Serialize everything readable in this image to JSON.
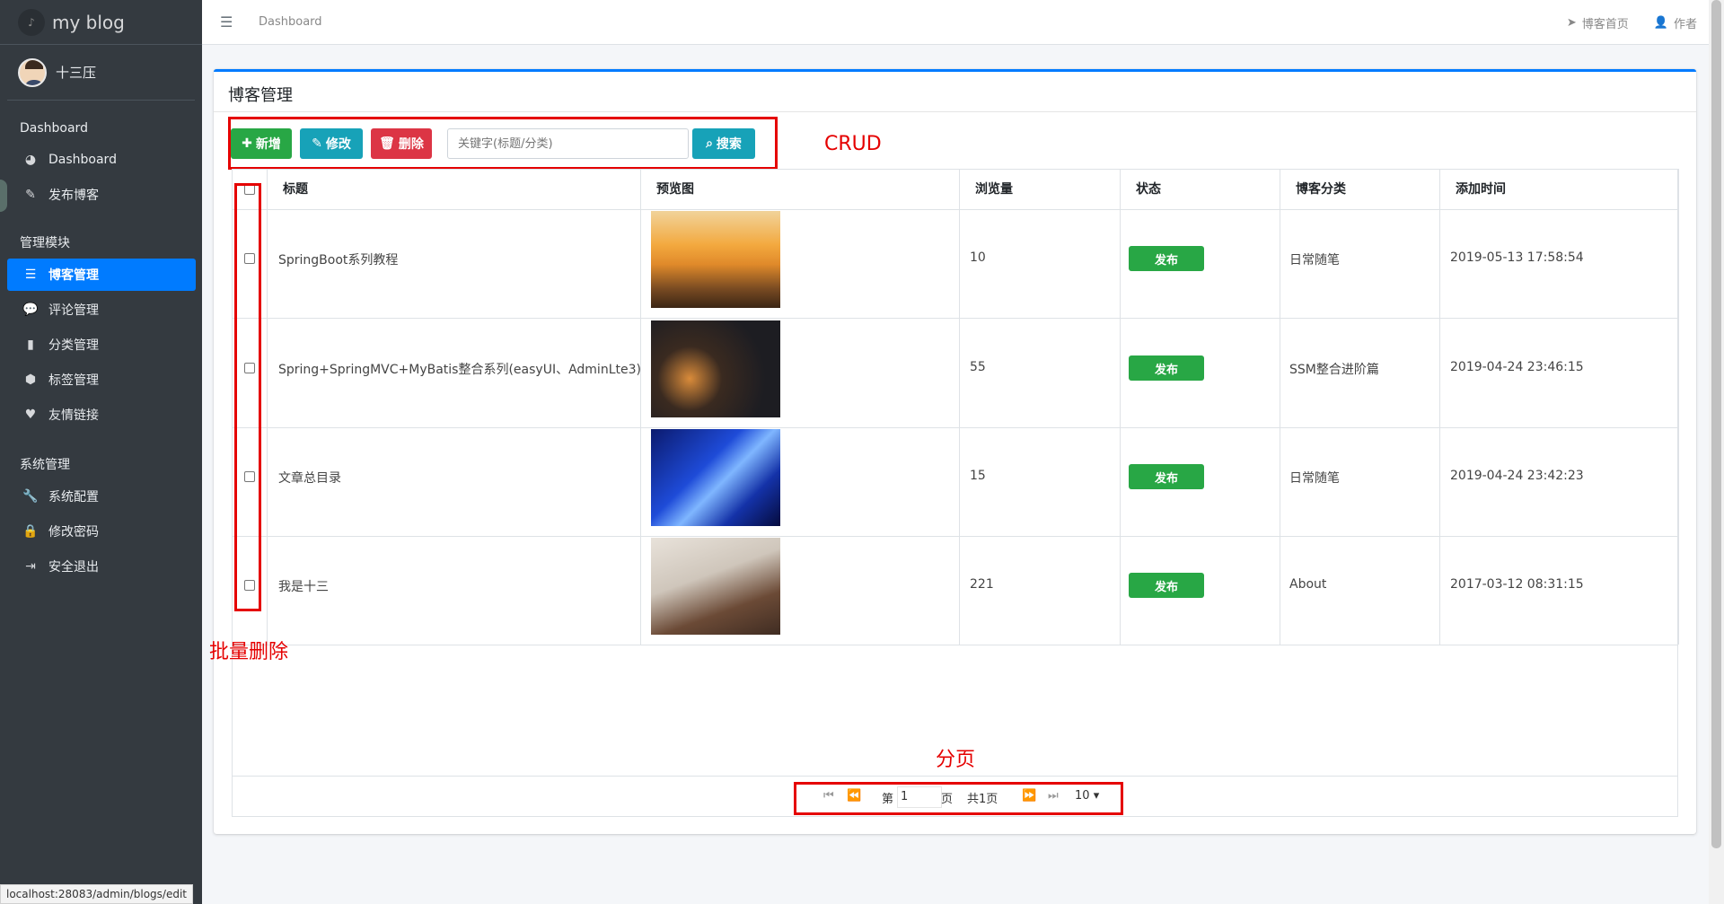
{
  "brand": {
    "title": "my blog"
  },
  "user": {
    "name": "十三压"
  },
  "nav": {
    "section_dashboard": "Dashboard",
    "dashboard": "Dashboard",
    "publish": "发布博客",
    "section_manage": "管理模块",
    "blog_manage": "博客管理",
    "comment_manage": "评论管理",
    "category_manage": "分类管理",
    "tag_manage": "标签管理",
    "friend_links": "友情链接",
    "section_system": "系统管理",
    "system_config": "系统配置",
    "change_password": "修改密码",
    "logout": "安全退出"
  },
  "topbar": {
    "breadcrumb": "Dashboard",
    "home": "博客首页",
    "author": "作者"
  },
  "card": {
    "title": "博客管理"
  },
  "toolbar": {
    "add": "新增",
    "edit": "修改",
    "delete": "删除",
    "search_placeholder": "关键字(标题/分类)",
    "search": "搜索"
  },
  "annotations": {
    "crud": "CRUD",
    "batch_delete": "批量删除",
    "paging": "分页"
  },
  "table": {
    "headers": [
      "标题",
      "预览图",
      "浏览量",
      "状态",
      "博客分类",
      "添加时间"
    ],
    "rows": [
      {
        "title": "SpringBoot系列教程",
        "views": "10",
        "status": "发布",
        "category": "日常随笔",
        "time": "2019-05-13 17:58:54"
      },
      {
        "title": "Spring+SpringMVC+MyBatis整合系列(easyUI、AdminLte3)",
        "views": "55",
        "status": "发布",
        "category": "SSM整合进阶篇",
        "time": "2019-04-24 23:46:15"
      },
      {
        "title": "文章总目录",
        "views": "15",
        "status": "发布",
        "category": "日常随笔",
        "time": "2019-04-24 23:42:23"
      },
      {
        "title": "我是十三",
        "views": "221",
        "status": "发布",
        "category": "About",
        "time": "2017-03-12 08:31:15"
      }
    ]
  },
  "pager": {
    "page_prefix": "第",
    "page_value": "1",
    "page_suffix": "页",
    "total": "共1页",
    "page_size": "10"
  },
  "statusbar": {
    "url": "localhost:28083/admin/blogs/edit"
  }
}
